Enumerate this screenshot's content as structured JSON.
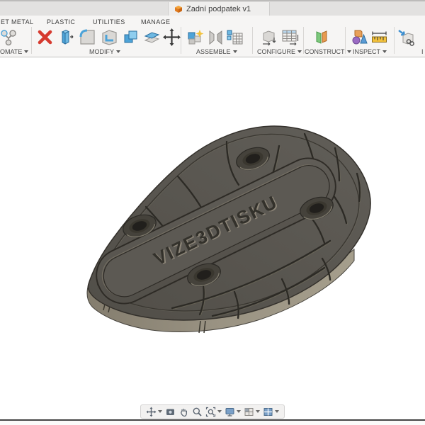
{
  "titlebar": {
    "document_tab": "Zadní podpatek v1"
  },
  "ribbon": {
    "tabs": [
      "ET METAL",
      "PLASTIC",
      "UTILITIES",
      "MANAGE"
    ],
    "groups": [
      {
        "label": "OMATE",
        "tools": [
          "automate"
        ]
      },
      {
        "label": "MODIFY",
        "tools": [
          "delete",
          "press-pull",
          "fillet",
          "shell",
          "combine",
          "offset-face",
          "move"
        ]
      },
      {
        "label": "ASSEMBLE",
        "tools": [
          "new-component",
          "joint",
          "component-table"
        ]
      },
      {
        "label": "CONFIGURE",
        "tools": [
          "configuration",
          "configuration-table"
        ]
      },
      {
        "label": "CONSTRUCT",
        "tools": [
          "construction-plane"
        ]
      },
      {
        "label": "INSPECT",
        "tools": [
          "analysis-shapes",
          "measure"
        ]
      },
      {
        "label": "I",
        "tools": [
          "insert"
        ]
      }
    ]
  },
  "viewport": {
    "background": "#ffffff",
    "model": {
      "name": "heel plate body",
      "engraved_text": "VIZE3DTISKU",
      "colors": {
        "top_face": "#57544e",
        "side_wall": "#958e7d",
        "groove": "#2c2a25",
        "hole_inner": "#211f1c"
      }
    }
  },
  "navbar": {
    "items": [
      {
        "name": "orbit",
        "dropdown": true
      },
      {
        "name": "look-at",
        "dropdown": false
      },
      {
        "name": "pan",
        "dropdown": false
      },
      {
        "name": "zoom",
        "dropdown": false
      },
      {
        "name": "fit",
        "dropdown": true
      },
      {
        "name": "display-settings",
        "dropdown": true
      },
      {
        "name": "grid-and-snaps",
        "dropdown": true
      },
      {
        "name": "viewports",
        "dropdown": true
      }
    ]
  },
  "palette": {
    "fusion_orange": "#e8832d",
    "icon_blue": "#4da3d8",
    "delete_red": "#d63a2f",
    "star_yellow": "#f3c23c",
    "construct_green": "#7cc87c",
    "construct_orange": "#e89a4f"
  }
}
